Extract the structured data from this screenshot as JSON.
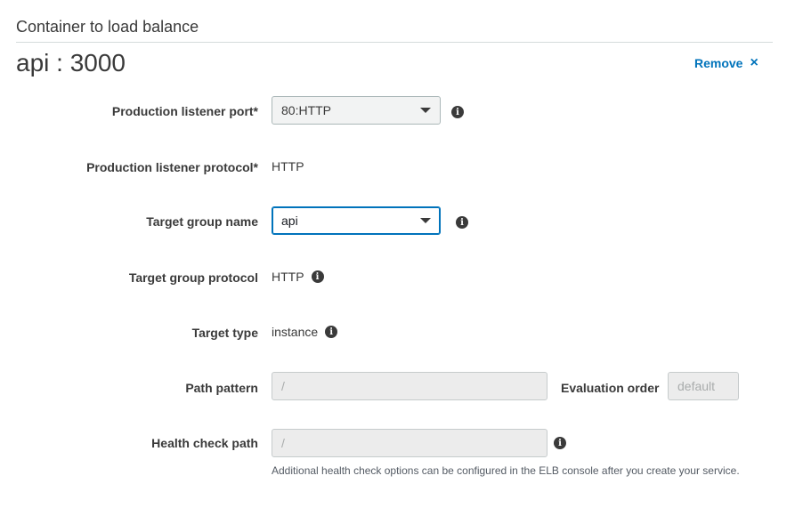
{
  "section": {
    "title": "Container to load balance",
    "container_name": "api : 3000",
    "remove_label": "Remove",
    "remove_icon": "×"
  },
  "fields": {
    "production_listener_port": {
      "label": "Production listener port*",
      "value": "80:HTTP"
    },
    "production_listener_protocol": {
      "label": "Production listener protocol*",
      "value": "HTTP"
    },
    "target_group_name": {
      "label": "Target group name",
      "value": "api"
    },
    "target_group_protocol": {
      "label": "Target group protocol",
      "value": "HTTP"
    },
    "target_type": {
      "label": "Target type",
      "value": "instance"
    },
    "path_pattern": {
      "label": "Path pattern",
      "placeholder": "/"
    },
    "evaluation_order": {
      "label": "Evaluation order",
      "placeholder": "default"
    },
    "health_check_path": {
      "label": "Health check path",
      "placeholder": "/"
    }
  },
  "help_text": "Additional health check options can be configured in the ELB console after you create your service.",
  "icons": {
    "info": "i"
  },
  "colors": {
    "link": "#0073bb",
    "focus_border": "#0073bb",
    "disabled_bg": "#ececec"
  }
}
